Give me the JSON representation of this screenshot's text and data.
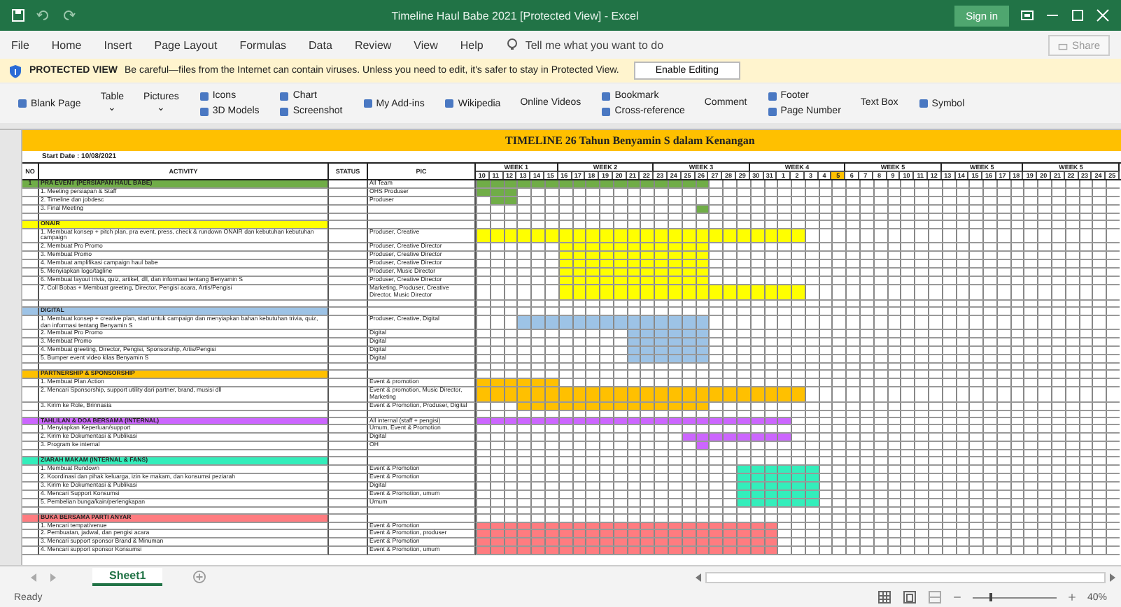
{
  "window": {
    "title": "Timeline Haul Babe 2021  [Protected View]  -  Excel",
    "sign_in": "Sign in"
  },
  "menu": [
    "File",
    "Home",
    "Insert",
    "Page Layout",
    "Formulas",
    "Data",
    "Review",
    "View",
    "Help"
  ],
  "tell_me": {
    "placeholder": "Tell me what you want to do"
  },
  "share": "Share",
  "protected_bar": {
    "label": "PROTECTED VIEW",
    "message": "Be careful—files from the Internet can contain viruses. Unless you need to edit, it's safer to stay in Protected View.",
    "button": "Enable Editing"
  },
  "ribbon": [
    {
      "kind": "single",
      "label": "Blank Page"
    },
    {
      "kind": "big",
      "label": "Table",
      "caret": "⌄"
    },
    {
      "kind": "big",
      "label": "Pictures",
      "caret": "⌄"
    },
    {
      "kind": "pair",
      "items": [
        "Icons",
        "3D Models"
      ]
    },
    {
      "kind": "pair",
      "items": [
        "Chart",
        "Screenshot"
      ]
    },
    {
      "kind": "single",
      "label": "My Add-ins"
    },
    {
      "kind": "single",
      "label": "Wikipedia"
    },
    {
      "kind": "big",
      "label": "Online Videos"
    },
    {
      "kind": "pair",
      "items": [
        "Bookmark",
        "Cross-reference"
      ]
    },
    {
      "kind": "big",
      "label": "Comment"
    },
    {
      "kind": "pair",
      "items": [
        "Footer",
        "Page Number"
      ]
    },
    {
      "kind": "big",
      "label": "Text Box"
    },
    {
      "kind": "single",
      "label": "Symbol"
    }
  ],
  "sheet": {
    "title": "TIMELINE 26 Tahun Benyamin S dalam Kenangan",
    "start_date": "Start Date : 10/08/2021",
    "columns": [
      "NO",
      "ACTIVITY",
      "STATUS",
      "PIC"
    ],
    "weeks": [
      {
        "label": "WEEK 1",
        "days": [
          {
            "day": "10",
            "highlighted": false
          },
          {
            "day": "11",
            "highlighted": false
          },
          {
            "day": "12",
            "highlighted": false
          },
          {
            "day": "13",
            "highlighted": false
          },
          {
            "day": "14",
            "highlighted": false
          },
          {
            "day": "15",
            "highlighted": false
          }
        ]
      },
      {
        "label": "WEEK 2",
        "days": [
          {
            "day": "16",
            "highlighted": false
          },
          {
            "day": "17",
            "highlighted": false
          },
          {
            "day": "18",
            "highlighted": false
          },
          {
            "day": "19",
            "highlighted": false
          },
          {
            "day": "20",
            "highlighted": false
          },
          {
            "day": "21",
            "highlighted": false
          },
          {
            "day": "22",
            "highlighted": false
          }
        ]
      },
      {
        "label": "WEEK 3",
        "days": [
          {
            "day": "23",
            "highlighted": false
          },
          {
            "day": "24",
            "highlighted": false
          },
          {
            "day": "25",
            "highlighted": false
          },
          {
            "day": "26",
            "highlighted": false
          },
          {
            "day": "27",
            "highlighted": false
          },
          {
            "day": "28",
            "highlighted": false
          },
          {
            "day": "29",
            "highlighted": false
          }
        ]
      },
      {
        "label": "WEEK 4",
        "days": [
          {
            "day": "30",
            "highlighted": false
          },
          {
            "day": "31",
            "highlighted": false
          },
          {
            "day": "1",
            "highlighted": false
          },
          {
            "day": "2",
            "highlighted": false
          },
          {
            "day": "3",
            "highlighted": false
          },
          {
            "day": "4",
            "highlighted": false
          },
          {
            "day": "5",
            "highlighted": true
          }
        ]
      },
      {
        "label": "WEEK 5",
        "days": [
          {
            "day": "6",
            "highlighted": false
          },
          {
            "day": "7",
            "highlighted": false
          },
          {
            "day": "8",
            "highlighted": false
          },
          {
            "day": "9",
            "highlighted": false
          },
          {
            "day": "10",
            "highlighted": false
          },
          {
            "day": "11",
            "highlighted": false
          },
          {
            "day": "12",
            "highlighted": false
          }
        ]
      },
      {
        "label": "WEEK 5",
        "days": [
          {
            "day": "13",
            "highlighted": false
          },
          {
            "day": "14",
            "highlighted": false
          },
          {
            "day": "15",
            "highlighted": false
          },
          {
            "day": "16",
            "highlighted": false
          },
          {
            "day": "17",
            "highlighted": false
          },
          {
            "day": "18",
            "highlighted": false
          }
        ]
      },
      {
        "label": "WEEK 5",
        "days": [
          {
            "day": "19",
            "highlighted": false
          },
          {
            "day": "20",
            "highlighted": false
          },
          {
            "day": "21",
            "highlighted": false
          },
          {
            "day": "22",
            "highlighted": false
          },
          {
            "day": "23",
            "highlighted": false
          },
          {
            "day": "24",
            "highlighted": false
          },
          {
            "day": "25",
            "highlighted": false
          }
        ]
      }
    ],
    "sections": [
      {
        "no": "1",
        "title": "PRA EVENT (PERSIAPAN HAUL BABE)",
        "pic": "All Team",
        "color": "#70ad47",
        "filled": [
          true,
          true,
          true,
          true,
          true,
          true,
          true,
          true,
          true,
          true,
          true,
          true,
          true,
          true,
          true,
          true,
          true
        ],
        "tasks": [
          {
            "activity": "1. Meeting persiapan & Staff",
            "pic": "OHS Produser",
            "filled": [
              true,
              true,
              true
            ]
          },
          {
            "activity": "2. Timeline dan jobdesc",
            "pic": "Produser",
            "filled": [
              false,
              true,
              true
            ]
          },
          {
            "activity": "3. Final Meeting",
            "filled": [
              false,
              false,
              false,
              false,
              false,
              false,
              false,
              false,
              false,
              false,
              false,
              false,
              false,
              false,
              false,
              false,
              true
            ]
          }
        ]
      },
      {
        "title": "ONAIR",
        "color": "#ffff00",
        "tasks": [
          {
            "activity": "1. Membuat konsep + pitch plan, pra event, press, check & rundown ONAIR dan kebutuhan kebutuhan campaign",
            "pic": "Produser, Creative",
            "filled": [
              true,
              true,
              true,
              true,
              true,
              true,
              true,
              true,
              true,
              true,
              true,
              true,
              true,
              true,
              true,
              true,
              true,
              true,
              true,
              true,
              true,
              true,
              true,
              true
            ]
          },
          {
            "activity": "2. Membuat Pro Promo",
            "pic": "Produser, Creative Director",
            "filled": [
              false,
              false,
              false,
              false,
              false,
              false,
              true,
              true,
              true,
              true,
              true,
              true,
              true,
              true,
              true,
              true,
              true
            ]
          },
          {
            "activity": "3. Membuat Promo",
            "pic": "Produser, Creative Director",
            "filled": [
              false,
              false,
              false,
              false,
              false,
              false,
              true,
              true,
              true,
              true,
              true,
              true,
              true,
              true,
              true,
              true,
              true
            ]
          },
          {
            "activity": "4. Membuat amplifikasi campaign haul babe",
            "pic": "Produser, Creative Director",
            "filled": [
              false,
              false,
              false,
              false,
              false,
              false,
              true,
              true,
              true,
              true,
              true,
              true,
              true,
              true,
              true,
              true,
              true
            ]
          },
          {
            "activity": "5. Menyiapkan logo/tagline",
            "pic": "Produser, Music Director",
            "filled": [
              false,
              false,
              false,
              false,
              false,
              false,
              true,
              true,
              true,
              true,
              true,
              true,
              true,
              true,
              true,
              true,
              true
            ]
          },
          {
            "activity": "6. Membuat layout trivia, quiz, artikel, dll, dan informasi tentang Benyamin S",
            "pic": "Produser, Creative Director",
            "filled": [
              false,
              false,
              false,
              false,
              false,
              false,
              true,
              true,
              true,
              true,
              true,
              true,
              true,
              true,
              true,
              true,
              true
            ]
          },
          {
            "activity": "7. Coll Bobas + Membuat greeting, Director, Pengisi acara, Artis/Pengisi",
            "pic": "Marketing, Produser, Creative Director, Music Director",
            "filled": [
              false,
              false,
              false,
              false,
              false,
              false,
              true,
              true,
              true,
              true,
              true,
              true,
              true,
              true,
              true,
              true,
              true,
              true,
              true,
              true,
              true,
              true,
              true,
              true
            ]
          }
        ]
      },
      {
        "title": "DIGITAL",
        "color": "#9dc3e6",
        "tasks": [
          {
            "activity": "1. Membuat konsep + creative plan, start untuk campaign dan menyiapkan bahan kebutuhan trivia, quiz, dan informasi tentang Benyamin S",
            "pic": "Produser, Creative, Digital",
            "filled": [
              false,
              false,
              false,
              true,
              true,
              true,
              true,
              true,
              true,
              true,
              true,
              true,
              true,
              true,
              true,
              true,
              true
            ]
          },
          {
            "activity": "2. Membuat Pro Promo",
            "pic": "Digital",
            "filled": [
              false,
              false,
              false,
              false,
              false,
              false,
              false,
              false,
              false,
              false,
              false,
              true,
              true,
              true,
              true,
              true,
              true
            ]
          },
          {
            "activity": "3. Membuat Promo",
            "pic": "Digital",
            "filled": [
              false,
              false,
              false,
              false,
              false,
              false,
              false,
              false,
              false,
              false,
              false,
              true,
              true,
              true,
              true,
              true,
              true
            ]
          },
          {
            "activity": "4. Membuat greeting, Director, Pengisi, Sponsorship, Artis/Pengisi",
            "pic": "Digital",
            "filled": [
              false,
              false,
              false,
              false,
              false,
              false,
              false,
              false,
              false,
              false,
              false,
              true,
              true,
              true,
              true,
              true,
              true
            ]
          },
          {
            "activity": "5. Bumper event video kilas Benyamin S",
            "pic": "Digital",
            "filled": [
              false,
              false,
              false,
              false,
              false,
              false,
              false,
              false,
              false,
              false,
              false,
              true,
              true,
              true,
              true,
              true,
              true
            ]
          }
        ]
      },
      {
        "title": "PARTNERSHIP & SPONSORSHIP",
        "color": "#ffc000",
        "tasks": [
          {
            "activity": "1. Membuat Plan Action",
            "pic": "Event & promotion",
            "filled": [
              true,
              true,
              true,
              true,
              true,
              true
            ]
          },
          {
            "activity": "2. Mencari Sponsorship, support utility dari partner, brand, musisi dll",
            "pic": "Event & promotion, Music Director, Marketing",
            "filled": [
              true,
              true,
              true,
              true,
              true,
              true,
              true,
              true,
              true,
              true,
              true,
              true,
              true,
              true,
              true,
              true,
              true,
              true,
              true,
              true,
              true,
              true,
              true,
              true
            ]
          },
          {
            "activity": "3. Kirim ke Role, Brinnasia",
            "pic": "Event & Promotion, Produser, Digital",
            "filled": [
              false,
              false,
              false,
              true,
              true,
              true,
              true,
              true,
              true,
              true,
              true,
              true,
              true,
              true,
              true,
              true,
              true
            ]
          }
        ]
      },
      {
        "title": "TAHLILAN & DOA BERSAMA (INTERNAL)",
        "pic": "All internal (staff + pengisi)",
        "color": "#cc66ff",
        "filled": [
          true,
          true,
          true,
          true,
          true,
          true,
          true,
          true,
          true,
          true,
          true,
          true,
          true,
          true,
          true,
          true,
          true,
          true,
          true,
          true,
          true,
          true,
          true
        ],
        "tasks": [
          {
            "activity": "1. Menyiapkan Keperluan/support",
            "pic": "Umum, Event & Promotion"
          },
          {
            "activity": "2. Kirim ke Dokumentasi & Publikasi",
            "pic": "Digital",
            "filled": [
              false,
              false,
              false,
              false,
              false,
              false,
              false,
              false,
              false,
              false,
              false,
              false,
              false,
              false,
              false,
              true,
              true,
              true,
              true,
              true,
              true,
              true,
              true
            ]
          },
          {
            "activity": "3. Program ke internal",
            "pic": "OH",
            "filled": [
              false,
              false,
              false,
              false,
              false,
              false,
              false,
              false,
              false,
              false,
              false,
              false,
              false,
              false,
              false,
              false,
              true
            ]
          }
        ]
      },
      {
        "title": "ZIARAH MAKAM (INTERNAL & FANS)",
        "color": "#33eebb",
        "tasks": [
          {
            "activity": "1. Membuat Rundown",
            "pic": "Event & Promotion",
            "filled": [
              false,
              false,
              false,
              false,
              false,
              false,
              false,
              false,
              false,
              false,
              false,
              false,
              false,
              false,
              false,
              false,
              false,
              false,
              false,
              true,
              true,
              true,
              true,
              true,
              true
            ]
          },
          {
            "activity": "2. Koordinasi dan pihak keluarga, izin ke makam, dan konsumsi peziarah",
            "pic": "Event & Promotion",
            "filled": [
              false,
              false,
              false,
              false,
              false,
              false,
              false,
              false,
              false,
              false,
              false,
              false,
              false,
              false,
              false,
              false,
              false,
              false,
              false,
              true,
              true,
              true,
              true,
              true,
              true
            ]
          },
          {
            "activity": "3. Kirim ke Dokumentasi & Publikasi",
            "pic": "Digital",
            "filled": [
              false,
              false,
              false,
              false,
              false,
              false,
              false,
              false,
              false,
              false,
              false,
              false,
              false,
              false,
              false,
              false,
              false,
              false,
              false,
              true,
              true,
              true,
              true,
              true,
              true
            ]
          },
          {
            "activity": "4. Mencari Support Konsumsi",
            "pic": "Event & Promotion, umum",
            "filled": [
              false,
              false,
              false,
              false,
              false,
              false,
              false,
              false,
              false,
              false,
              false,
              false,
              false,
              false,
              false,
              false,
              false,
              false,
              false,
              true,
              true,
              true,
              true,
              true,
              true
            ]
          },
          {
            "activity": "5. Pembelian bunga/kain/perlengkapan",
            "pic": "Umum",
            "filled": [
              false,
              false,
              false,
              false,
              false,
              false,
              false,
              false,
              false,
              false,
              false,
              false,
              false,
              false,
              false,
              false,
              false,
              false,
              false,
              true,
              true,
              true,
              true,
              true,
              true
            ]
          }
        ]
      },
      {
        "title": "BUKA BERSAMA PARTI ANYAR",
        "color": "#ff7c80",
        "tasks": [
          {
            "activity": "1. Mencari tempat/venue",
            "pic": "Event & Promotion",
            "filled": [
              true,
              true,
              true,
              true,
              true,
              true,
              true,
              true,
              true,
              true,
              true,
              true,
              true,
              true,
              true,
              true,
              true,
              true,
              true,
              true,
              true,
              true
            ]
          },
          {
            "activity": "2. Pembuatan, jadwal, dan pengisi acara",
            "pic": "Event & Promotion, produser",
            "filled": [
              true,
              true,
              true,
              true,
              true,
              true,
              true,
              true,
              true,
              true,
              true,
              true,
              true,
              true,
              true,
              true,
              true,
              true,
              true,
              true,
              true,
              true
            ]
          },
          {
            "activity": "3. Mencari support sponsor Brand & Minuman",
            "pic": "Event & Promotion",
            "filled": [
              true,
              true,
              true,
              true,
              true,
              true,
              true,
              true,
              true,
              true,
              true,
              true,
              true,
              true,
              true,
              true,
              true,
              true,
              true,
              true,
              true,
              true
            ]
          },
          {
            "activity": "4. Mencari support sponsor Konsumsi",
            "pic": "Event & Promotion, umum",
            "filled": [
              true,
              true,
              true,
              true,
              true,
              true,
              true,
              true,
              true,
              true,
              true,
              true,
              true,
              true,
              true,
              true,
              true,
              true,
              true,
              true,
              true,
              true
            ]
          }
        ]
      }
    ]
  },
  "sheet_tab": "Sheet1",
  "status": {
    "text": "Ready",
    "zoom": "40%",
    "zoom_slider": {
      "level": 0.2
    }
  }
}
